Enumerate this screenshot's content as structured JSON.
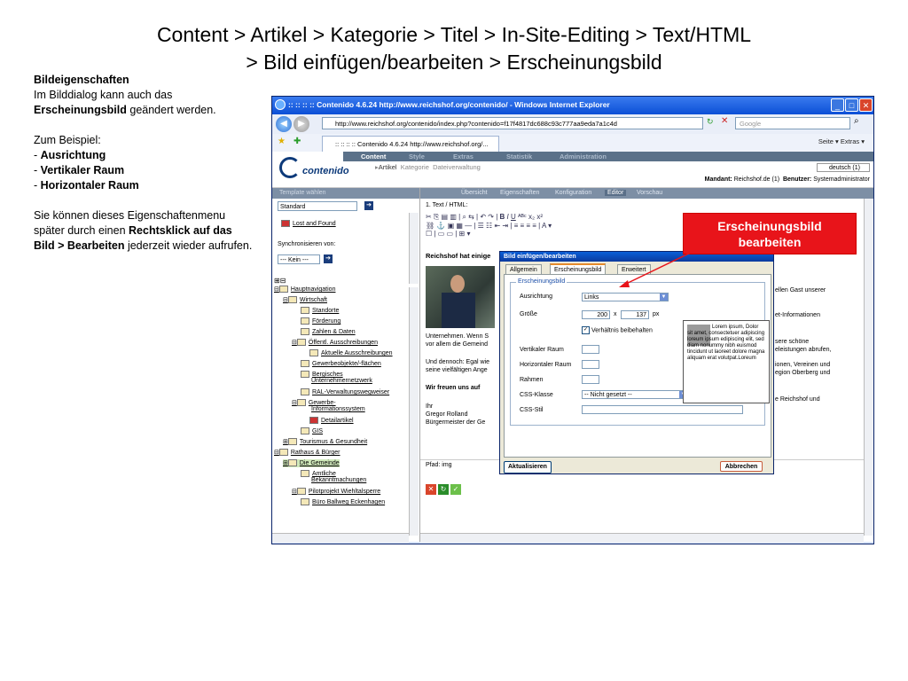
{
  "slide": {
    "title_line1": "Content > Artikel > Kategorie > Titel > In-Site-Editing > Text/HTML",
    "title_line2": "> Bild einfügen/bearbeiten > Erscheinungsbild"
  },
  "left_text": {
    "heading": "Bildeigenschaften",
    "p1_a": "Im Bilddialog kann auch das ",
    "p1_b": "Erscheinungsbild",
    "p1_c": " geändert werden.",
    "example_intro": "Zum Beispiel:",
    "items": [
      "Ausrichtung",
      "Vertikaler Raum",
      "Horizontaler Raum"
    ],
    "p3_a": "Sie können dieses Eigenschaftenmenu später durch einen ",
    "p3_b": "Rechtsklick auf das Bild > Bearbeiten",
    "p3_c": " jederzeit wieder aufrufen."
  },
  "browser": {
    "title": ":: :: :: :: Contenido 4.6.24 http://www.reichshof.org/contenido/ - Windows Internet Explorer",
    "address": "http://www.reichshof.org/contenido/index.php?contenido=f17f4817dc688c93c777aa9eda7a1c4d",
    "search_placeholder": "Google",
    "tab_label": ":: :: :: :: Contenido 4.6.24 http://www.reichshof.org/...",
    "tools": "Seite ▾   Extras ▾"
  },
  "contenido": {
    "logo": "contenido",
    "main_nav": [
      "Content",
      "Style",
      "Extras",
      "Statistik",
      "Administration"
    ],
    "sub_nav": [
      "Artikel",
      "Kategorie",
      "Dateiverwaltung"
    ],
    "language": "deutsch (1)",
    "mandant_label": "Mandant:",
    "mandant_value": "Reichshof.de (1)",
    "benutzer_label": "Benutzer:",
    "benutzer_value": "Systemadministrator"
  },
  "left_panel": {
    "header": "Template wählen",
    "template_select": "Standard",
    "lost_found": "Lost and Found",
    "sync_label": "Synchronisieren von:",
    "sync_select": "--- Kein ---",
    "tree": [
      "Hauptnavigation",
      "Wirtschaft",
      "Standorte",
      "Förderung",
      "Zahlen & Daten",
      "Öffentl. Ausschreibungen",
      "Aktuelle Ausschreibungen",
      "Gewerbeobjekte/-flächen",
      "Bergisches",
      "Unternehmernetzwerk",
      "RAL-Verwaltungswegweiser",
      "Gewerbe-",
      "Informationssystem",
      "Detailartikel",
      "GIS",
      "Tourismus & Gesundheit",
      "Rathaus & Bürger",
      "Die Gemeinde",
      "Amtliche",
      "Bekanntmachungen",
      "Pilotprojekt Wiehltalsperre",
      "Büro Ballweg Eckenhagen"
    ]
  },
  "right_panel": {
    "tabs": [
      "Übersicht",
      "Eigenschaften",
      "Konfiguration",
      "Editor",
      "Vorschau"
    ],
    "label": "1. Text / HTML:",
    "heading_text": "Reichshof hat einige",
    "lines": [
      "Unternehmen. Wenn S",
      "vor allem die Gemeind",
      "Und dennoch: Egal wie",
      "seine vielfältigen Ange",
      "Wir freuen uns auf",
      "Ihr",
      "Gregor Rolland",
      "Bürgermeister der Ge"
    ],
    "right_fragments": [
      "ellen Gast unserer",
      "et-Informationen",
      "sere schöne",
      "eleistungen abrufen,",
      "ionen, Vereinen und",
      "egion Oberberg und",
      "e Reichshof und"
    ],
    "path": "Pfad: img"
  },
  "dialog": {
    "title": "Bild einfügen/bearbeiten",
    "tabs": [
      "Allgemein",
      "Erscheinungsbild",
      "Erweitert"
    ],
    "legend": "Erscheinungsbild",
    "ausrichtung_label": "Ausrichtung",
    "ausrichtung_value": "Links",
    "groesse_label": "Größe",
    "width": "200",
    "height": "137",
    "times": "x",
    "unit": "px",
    "keep_ratio": "Verhältnis beibehalten",
    "vert_label": "Vertikaler Raum",
    "horiz_label": "Horizontaler Raum",
    "rahmen_label": "Rahmen",
    "css_klasse_label": "CSS-Klasse",
    "css_klasse_value": "-- Nicht gesetzt --",
    "css_stil_label": "CSS-Stil",
    "preview_text": "Lorem ipsum, Dolor sit amet, consectetuer adipiscing loreum ipsum edipiscing elit, sed diam nonummy nibh euismod tincidunt ut laoreet dolore magna aliquam erat volutpat.Loreum",
    "update_button": "Aktualisieren",
    "cancel_button": "Abbrechen"
  },
  "callout": {
    "line1": "Erscheinungsbild",
    "line2": "bearbeiten",
    "color": "#e8141a"
  }
}
